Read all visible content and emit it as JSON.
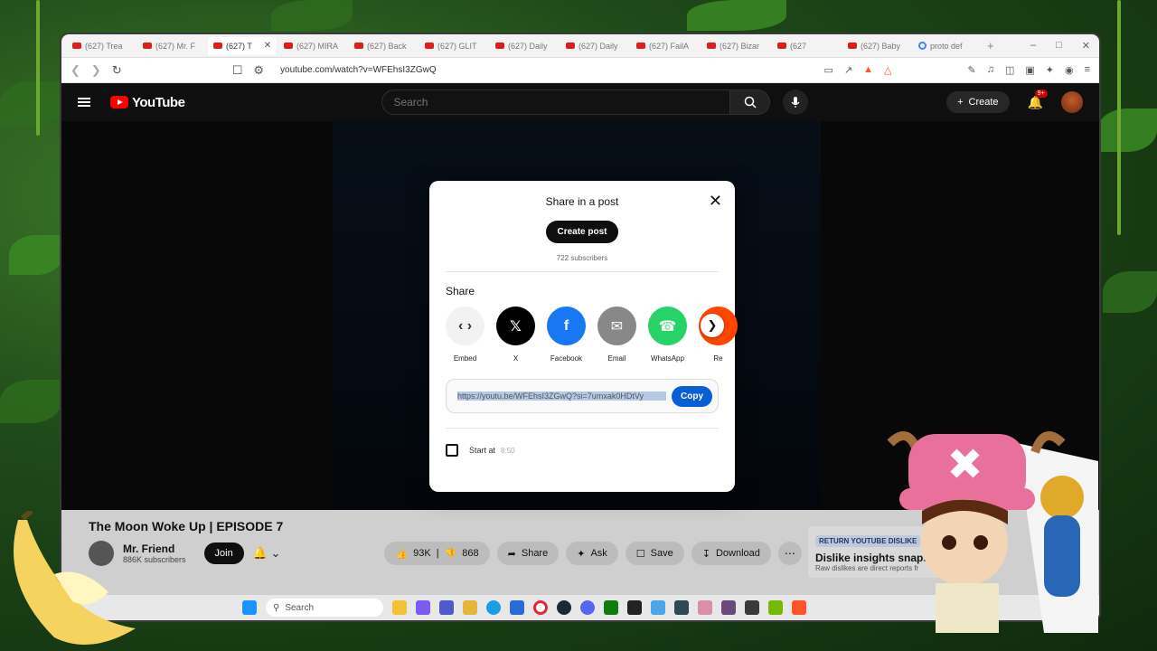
{
  "tabs": [
    {
      "label": "(627) Trea",
      "icon": "youtube-icon"
    },
    {
      "label": "(627) Mr. F",
      "icon": "youtube-icon"
    },
    {
      "label": "(627) T",
      "icon": "youtube-icon",
      "active": true
    },
    {
      "label": "(627) MIRA",
      "icon": "youtube-icon"
    },
    {
      "label": "(627) Back",
      "icon": "youtube-icon"
    },
    {
      "label": "(627) GLIT",
      "icon": "youtube-icon"
    },
    {
      "label": "(627) Daily",
      "icon": "youtube-icon"
    },
    {
      "label": "(627) Daily",
      "icon": "youtube-icon"
    },
    {
      "label": "(627) FailA",
      "icon": "youtube-icon"
    },
    {
      "label": "(627) Bizar",
      "icon": "youtube-icon"
    },
    {
      "label": "(627",
      "icon": "youtube-icon"
    },
    {
      "label": "(627) Baby",
      "icon": "youtube-icon"
    },
    {
      "label": "proto def",
      "icon": "google-icon"
    }
  ],
  "address": {
    "url": "youtube.com/watch?v=WFEhsI3ZGwQ"
  },
  "yt": {
    "logo": "YouTube",
    "search_placeholder": "Search",
    "create_label": "Create",
    "notif_badge": "9+"
  },
  "video": {
    "title": "The Moon Woke Up | EPISODE 7",
    "channel": "Mr. Friend",
    "subscribers": "886K subscribers",
    "join": "Join",
    "likes": "93K",
    "dislikes": "868",
    "share": "Share",
    "ask": "Ask",
    "save": "Save",
    "download": "Download"
  },
  "dislike_ext": {
    "tag": "RETURN YOUTUBE DISLIKE",
    "heading": "Dislike insights snapshot",
    "sub": "Raw dislikes are direct reports fr"
  },
  "modal": {
    "title": "Share in a post",
    "create_post": "Create post",
    "subs": "722 subscribers",
    "share_label": "Share",
    "targets": [
      {
        "name": "Embed",
        "color": "#f2f2f2",
        "icon": "embed-icon"
      },
      {
        "name": "X",
        "color": "#000000",
        "icon": "x-icon"
      },
      {
        "name": "Facebook",
        "color": "#1877f2",
        "icon": "facebook-icon"
      },
      {
        "name": "Email",
        "color": "#888888",
        "icon": "email-icon"
      },
      {
        "name": "WhatsApp",
        "color": "#25d366",
        "icon": "whatsapp-icon"
      },
      {
        "name": "Re",
        "color": "#ff4500",
        "icon": "reddit-icon"
      }
    ],
    "link": "https://youtu.be/WFEhsI3ZGwQ?si=7umxak0HDtVy",
    "copy": "Copy",
    "start_at": "Start at",
    "start_time": "8:50"
  },
  "taskbar": {
    "search": "Search"
  }
}
